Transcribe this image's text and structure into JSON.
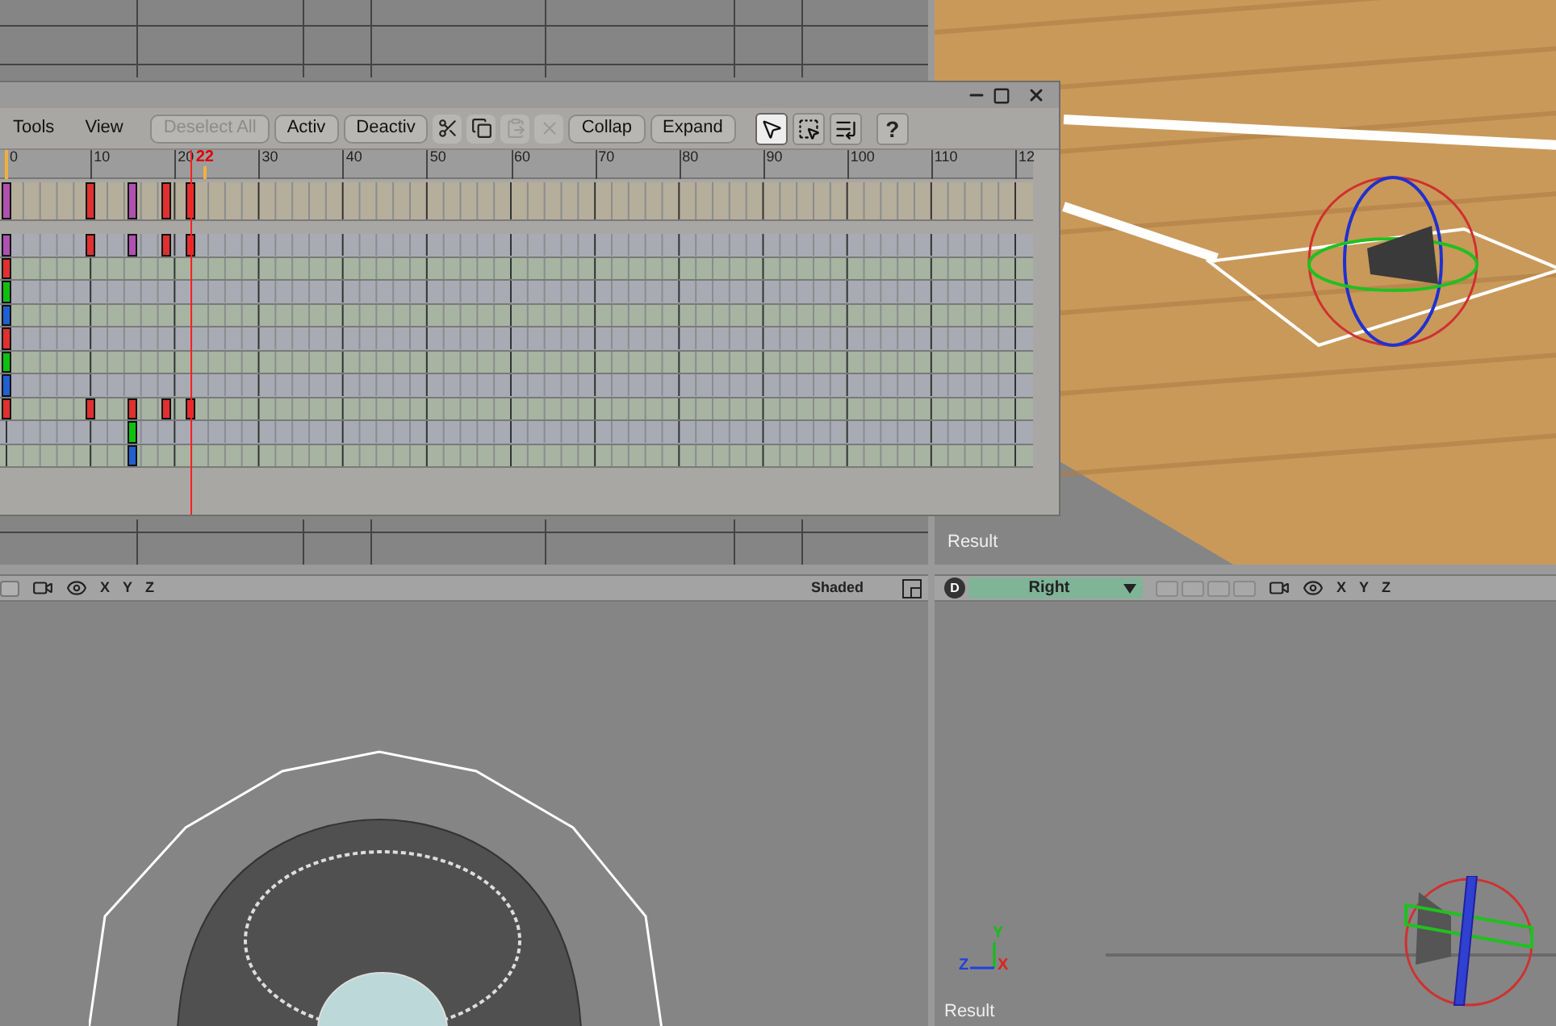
{
  "top_right_viewport": {
    "label": "Result"
  },
  "bottom_left_viewport": {
    "axes": [
      "X",
      "Y",
      "Z"
    ],
    "shading": "Shaded"
  },
  "bottom_right_viewport": {
    "display_button": "D",
    "view": "Right",
    "axes": [
      "X",
      "Y",
      "Z"
    ],
    "gizmo_axes": [
      "Y",
      "Z",
      "X"
    ],
    "label": "Result"
  },
  "dopesheet": {
    "menus": [
      "Tools",
      "View"
    ],
    "text_buttons": [
      {
        "label": "Deselect All",
        "disabled": true
      },
      {
        "label": "Activ",
        "disabled": false
      },
      {
        "label": "Deactiv",
        "disabled": false
      }
    ],
    "edit_icons": [
      {
        "disabled": false
      },
      {
        "disabled": false
      },
      {
        "disabled": true
      },
      {
        "disabled": true
      }
    ],
    "more_buttons": [
      "Collap",
      "Expand"
    ],
    "tools": [
      {
        "selected": true
      },
      {
        "selected": false
      },
      {
        "selected": false
      }
    ],
    "help": "?",
    "ruler": [
      "0",
      "10",
      "20",
      "30",
      "40",
      "50",
      "60",
      "70",
      "80",
      "90",
      "100",
      "110",
      "12"
    ],
    "playhead": {
      "label": "22",
      "level": 0.183
    },
    "range": {
      "level": 0.197
    },
    "tracks": [
      {
        "kind": "summary",
        "keys": [
          {
            "level": 0,
            "color": "#b050b0"
          },
          {
            "level": 0.083,
            "color": "#e03030"
          },
          {
            "level": 0.125,
            "color": "#b050b0"
          },
          {
            "level": 0.158,
            "color": "#e03030"
          },
          {
            "level": 0.183,
            "color": "#e03030"
          }
        ]
      },
      {
        "kind": "track",
        "keys": [
          {
            "level": 0,
            "color": "#b050b0"
          },
          {
            "level": 0.083,
            "color": "#e03030"
          },
          {
            "level": 0.125,
            "color": "#b050b0"
          },
          {
            "level": 0.158,
            "color": "#e03030"
          },
          {
            "level": 0.183,
            "color": "#e03030"
          }
        ]
      },
      {
        "kind": "track",
        "keys": [
          {
            "level": 0,
            "color": "#e03030"
          }
        ]
      },
      {
        "kind": "track",
        "keys": [
          {
            "level": 0,
            "color": "#10c010"
          }
        ]
      },
      {
        "kind": "track",
        "keys": [
          {
            "level": 0,
            "color": "#2060d0"
          }
        ]
      },
      {
        "kind": "track",
        "keys": [
          {
            "level": 0,
            "color": "#e03030"
          }
        ]
      },
      {
        "kind": "track",
        "keys": [
          {
            "level": 0,
            "color": "#10c010"
          }
        ]
      },
      {
        "kind": "track",
        "keys": [
          {
            "level": 0,
            "color": "#2060d0"
          }
        ]
      },
      {
        "kind": "track",
        "keys": [
          {
            "level": 0,
            "color": "#e03030"
          },
          {
            "level": 0.083,
            "color": "#e03030"
          },
          {
            "level": 0.125,
            "color": "#e03030"
          },
          {
            "level": 0.158,
            "color": "#e03030"
          },
          {
            "level": 0.183,
            "color": "#e03030"
          }
        ]
      },
      {
        "kind": "track",
        "keys": [
          {
            "level": 0.125,
            "color": "#10c010"
          }
        ]
      },
      {
        "kind": "track",
        "keys": [
          {
            "level": 0.125,
            "color": "#2060d0"
          }
        ]
      }
    ]
  }
}
